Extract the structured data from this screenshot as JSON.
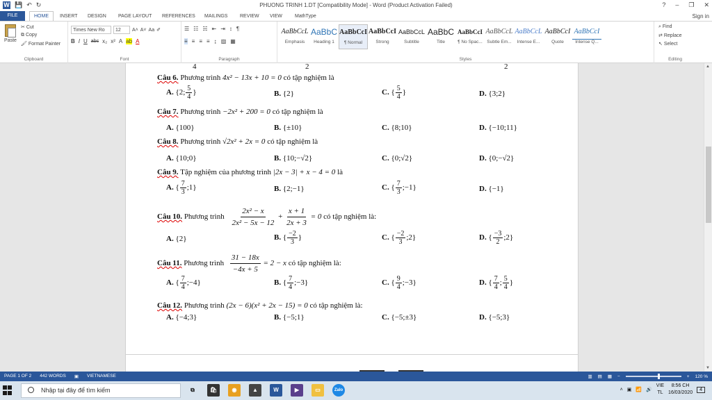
{
  "window": {
    "title": "PHUONG TRINH 1.DT [Compatibility Mode] - Word (Product Activation Failed)",
    "help": "?",
    "min": "–",
    "restore": "❐",
    "close": "✕"
  },
  "tabs": [
    "FILE",
    "HOME",
    "INSERT",
    "DESIGN",
    "PAGE LAYOUT",
    "REFERENCES",
    "MAILINGS",
    "REVIEW",
    "VIEW",
    "MathType"
  ],
  "sign_in": "Sign in",
  "ribbon": {
    "clipboard": {
      "paste": "Paste",
      "cut": "Cut",
      "copy": "Copy",
      "format_painter": "Format Painter",
      "label": "Clipboard"
    },
    "font": {
      "name": "Times New Ro",
      "size": "12",
      "label": "Font"
    },
    "paragraph": {
      "label": "Paragraph"
    },
    "styles": {
      "label": "Styles",
      "items": [
        {
          "sample": "AaBbCcL",
          "name": "Emphasis"
        },
        {
          "sample": "AaBbC",
          "name": "Heading 1"
        },
        {
          "sample": "AaBbCcI",
          "name": "¶ Normal"
        },
        {
          "sample": "AaBbCcI",
          "name": "Strong"
        },
        {
          "sample": "AaBbCcL",
          "name": "Subtitle"
        },
        {
          "sample": "AaBbC",
          "name": "Title"
        },
        {
          "sample": "AaBbCcI",
          "name": "¶ No Spac..."
        },
        {
          "sample": "AaBbCcL",
          "name": "Subtle Em..."
        },
        {
          "sample": "AaBbCcL",
          "name": "Intense E..."
        },
        {
          "sample": "AaBbCcI",
          "name": "Quote"
        },
        {
          "sample": "AaBbCcI",
          "name": "Intense Q..."
        }
      ]
    },
    "editing": {
      "find": "Find",
      "replace": "Replace",
      "select": "Select",
      "label": "Editing"
    }
  },
  "document": {
    "top_fragments": {
      "left": "4",
      "mid": "2",
      "right": "2"
    },
    "q6": {
      "label": "Câu 6.",
      "text": "Phương trình",
      "eq": "4x² − 13x + 10 = 0",
      "tail": "có tập nghiệm là",
      "a": "A.",
      "a_pre": "{2;",
      "a_num": "5",
      "a_den": "4",
      "a_post": "}",
      "b": "B.",
      "b_val": "{2}",
      "c": "C.",
      "c_pre": "{",
      "c_num": "5",
      "c_den": "4",
      "c_post": "}",
      "d": "D.",
      "d_val": "{3;2}"
    },
    "q7": {
      "label": "Câu 7.",
      "text": "Phương trình",
      "eq": "−2x² + 200 = 0",
      "tail": "có tập nghiệm là",
      "a": "A.",
      "a_val": "{100}",
      "b": "B.",
      "b_val": "{±10}",
      "c": "C.",
      "c_val": "{8;10}",
      "d": "D.",
      "d_val": "{−10;11}"
    },
    "q8": {
      "label": "Câu 8.",
      "text": "Phương trình",
      "eq": "√2x² + 2x = 0",
      "tail": "có tập nghiệm là",
      "a": "A.",
      "a_val": "{10;0}",
      "b": "B.",
      "b_val": "{10;−√2}",
      "c": "C.",
      "c_val": "{0;√2}",
      "d": "D.",
      "d_val": "{0;−√2}"
    },
    "q9": {
      "label": "Câu 9.",
      "text": "Tập nghiệm của phương trình",
      "eq": "|2x − 3| + x − 4 = 0",
      "tail": "là",
      "a": "A.",
      "a_pre": "{",
      "a_num": "7",
      "a_den": "3",
      "a_post": ";1}",
      "b": "B.",
      "b_val": "{2;−1}",
      "c": "C.",
      "c_pre": "{",
      "c_num": "7",
      "c_den": "3",
      "c_post": ";−1}",
      "d": "D.",
      "d_val": "{−1}"
    },
    "q10": {
      "label": "Câu 10.",
      "text": "Phương trình",
      "f1_num": "2x² − x",
      "f1_den": "2x² − 5x − 12",
      "plus": "+",
      "f2_num": "x + 1",
      "f2_den": "2x + 3",
      "rhs": "= 0",
      "tail": "có tập nghiệm là:",
      "a": "A.",
      "a_val": "{2}",
      "b": "B.",
      "b_pre": "{",
      "b_num": "−2",
      "b_den": "3",
      "b_post": "}",
      "c": "C.",
      "c_pre": "{",
      "c_num": "−2",
      "c_den": "3",
      "c_post": ";2}",
      "d": "D.",
      "d_pre": "{",
      "d_num": "−3",
      "d_den": "2",
      "d_post": ";2}"
    },
    "q11": {
      "label": "Câu 11.",
      "text": "Phương trình",
      "f_num": "31 − 18x",
      "f_den": "−4x + 5",
      "rhs": "= 2 − x",
      "tail": "có tập nghiệm là:",
      "a": "A.",
      "a_pre": "{",
      "a_num": "7",
      "a_den": "4",
      "a_post": ";−4}",
      "b": "B.",
      "b_pre": "{",
      "b_num": "7",
      "b_den": "4",
      "b_post": ";−3}",
      "c": "C.",
      "c_pre": "{",
      "c_num": "9",
      "c_den": "4",
      "c_post": ";−3}",
      "d": "D.",
      "d_pre": "{",
      "d_num1": "7",
      "d_den1": "4",
      "d_mid": ";",
      "d_num2": "5",
      "d_den2": "4",
      "d_post": "}"
    },
    "q12": {
      "label": "Câu 12.",
      "text": "Phương trình",
      "eq": "(2x − 6)(x² + 2x − 15) = 0",
      "tail": "có tập nghiệm là:",
      "a": "A.",
      "a_val": "{−4;3}",
      "b": "B.",
      "b_val": "{−5;1}",
      "c": "C.",
      "c_val": "{−5;±3}",
      "d": "D.",
      "d_val": "{−5;3}"
    }
  },
  "status": {
    "page": "PAGE 1 OF 2",
    "words": "442 WORDS",
    "lang": "VIETNAMESE",
    "zoom": "120 %"
  },
  "taskbar": {
    "search_placeholder": "Nhập tại đây để tìm kiếm",
    "lang": "VIE",
    "lang2": "TL",
    "time": "8:56 CH",
    "date": "16/03/2020",
    "notif": "4"
  }
}
